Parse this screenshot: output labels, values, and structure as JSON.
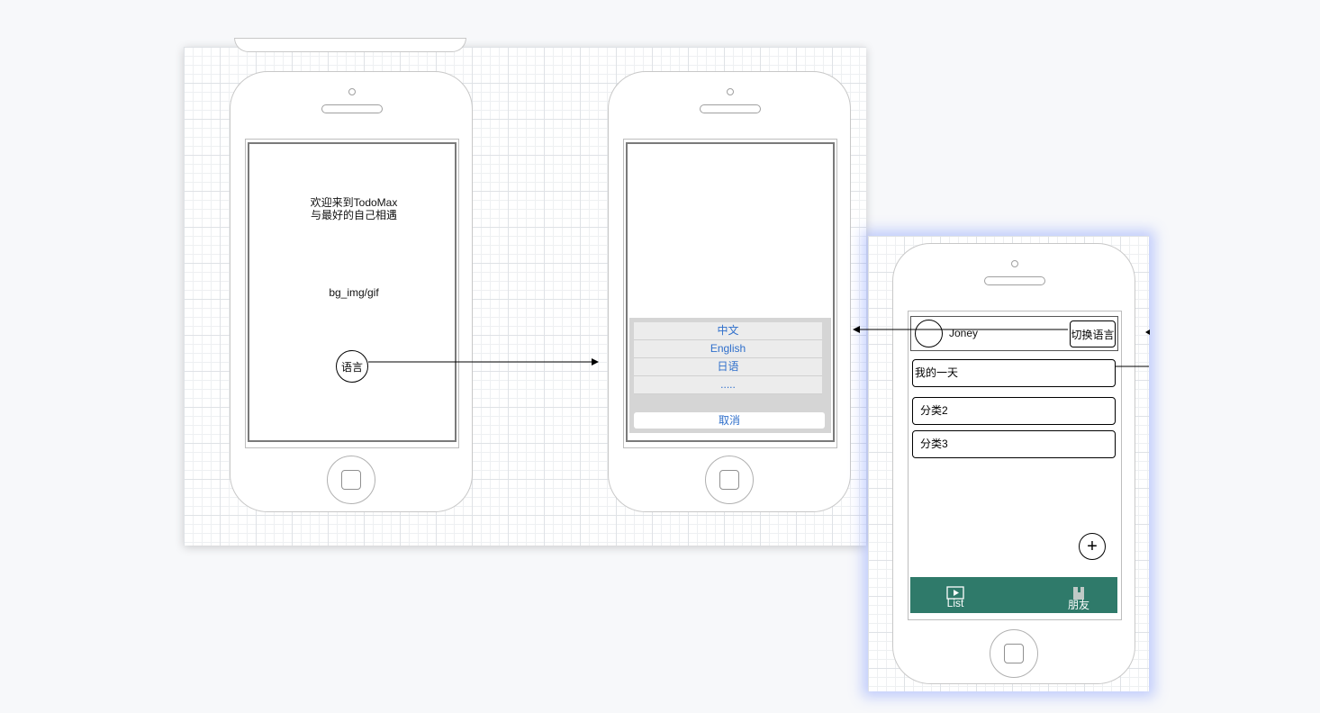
{
  "screen1": {
    "welcome_line1": "欢迎来到TodoMax",
    "welcome_line2": "与最好的自己相遇",
    "bg_label": "bg_img/gif",
    "language_button": "语言"
  },
  "screen2": {
    "language_options": [
      "中文",
      "English",
      "日语",
      "....."
    ],
    "cancel_label": "取消"
  },
  "screen3": {
    "user_name": "Joney",
    "switch_language_button": "切换语言",
    "categories": [
      "我的一天",
      "分类2",
      "分类3"
    ],
    "add_button": "+",
    "tabs": {
      "list_label": "List",
      "friends_label": "朋友"
    },
    "tabbar_color": "#2f7a6a"
  },
  "icons": [
    "camera-icon",
    "speaker-icon",
    "home-button-icon",
    "play-icon",
    "book-icon",
    "plus-icon"
  ]
}
